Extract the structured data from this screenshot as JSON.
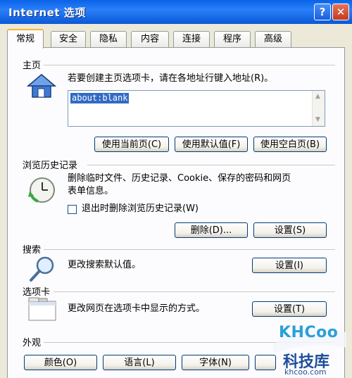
{
  "window": {
    "title": "Internet 选项",
    "help_glyph": "?",
    "close_glyph": "✕"
  },
  "tabs": [
    {
      "label": "常规",
      "active": true
    },
    {
      "label": "安全"
    },
    {
      "label": "隐私"
    },
    {
      "label": "内容"
    },
    {
      "label": "连接"
    },
    {
      "label": "程序"
    },
    {
      "label": "高级"
    }
  ],
  "homepage": {
    "heading": "主页",
    "instruction": "若要创建主页选项卡，请在各地址行键入地址(R)。",
    "address_value": "about:blank",
    "use_current": "使用当前页(C)",
    "use_default": "使用默认值(F)",
    "use_blank": "使用空白页(B)"
  },
  "history": {
    "heading": "浏览历史记录",
    "description_line1": "删除临时文件、历史记录、Cookie、保存的密码和网页",
    "description_line2": "表单信息。",
    "checkbox_label": "退出时删除浏览历史记录(W)",
    "delete_button": "删除(D)...",
    "settings_button": "设置(S)"
  },
  "search": {
    "heading": "搜索",
    "description": "更改搜索默认值。",
    "settings_button": "设置(I)"
  },
  "tabs_section": {
    "heading": "选项卡",
    "description": "更改网页在选项卡中显示的方式。",
    "settings_button": "设置(T)"
  },
  "appearance": {
    "heading": "外观",
    "colors_button": "颜色(O)",
    "languages_button": "语言(L)",
    "fonts_button": "字体(N)"
  },
  "watermark": {
    "logo": "KHCoo",
    "site_cn": "科技库",
    "url": "khcoo.com"
  }
}
